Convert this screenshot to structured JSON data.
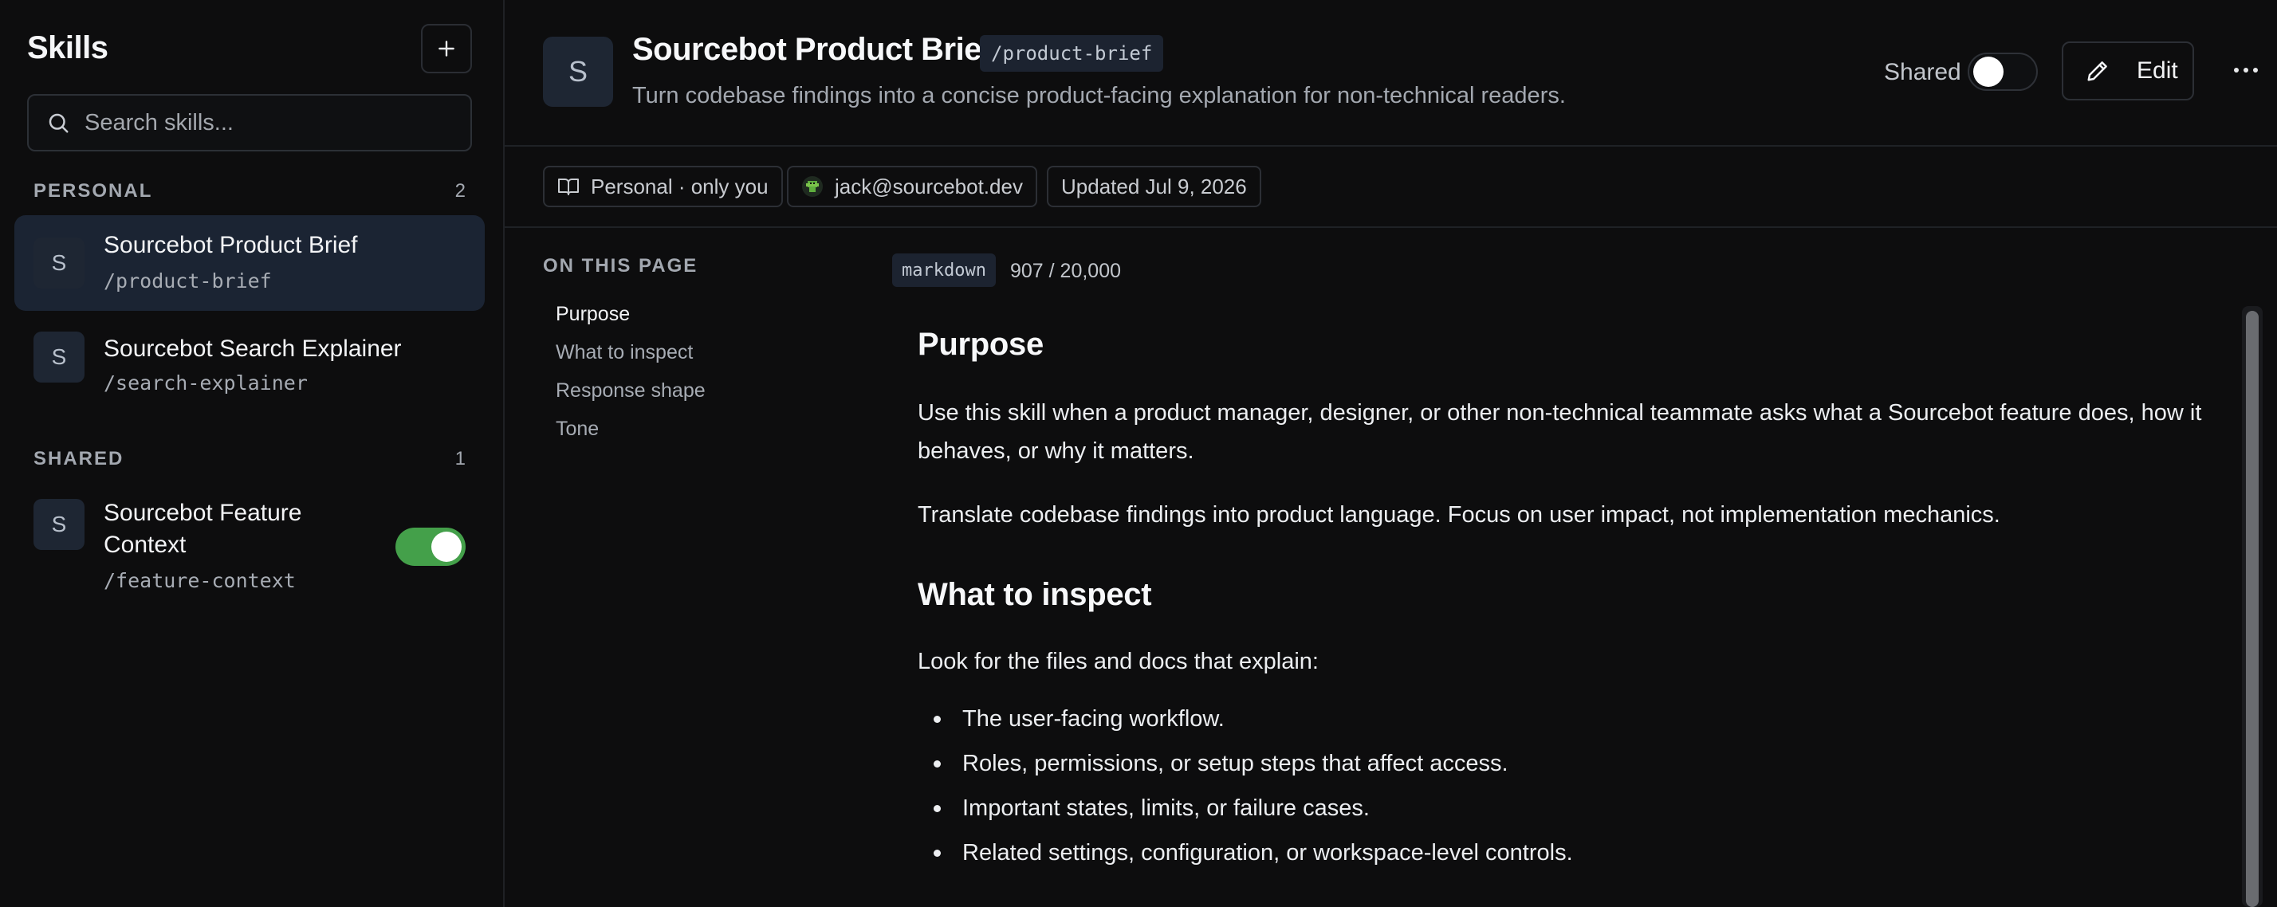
{
  "sidebar": {
    "title": "Skills",
    "search_placeholder": "Search skills...",
    "sections": [
      {
        "label": "PERSONAL",
        "count": "2"
      },
      {
        "label": "SHARED",
        "count": "1"
      }
    ],
    "personal_items": [
      {
        "avatar": "S",
        "name": "Sourcebot Product Brief",
        "slug": "/product-brief",
        "active": true
      },
      {
        "avatar": "S",
        "name": "Sourcebot Search Explainer",
        "slug": "/search-explainer",
        "active": false
      }
    ],
    "shared_items": [
      {
        "avatar": "S",
        "name_line1": "Sourcebot Feature",
        "name_line2": "Context",
        "slug": "/feature-context",
        "enabled": true
      }
    ]
  },
  "header": {
    "avatar": "S",
    "title": "Sourcebot Product Brief",
    "slug": "/product-brief",
    "description": "Turn codebase findings into a concise product-facing explanation for non-technical readers.",
    "shared_label": "Shared",
    "shared_on": false,
    "edit_label": "Edit"
  },
  "meta": {
    "visibility": "Personal · only you",
    "author": "jack@sourcebot.dev",
    "updated": "Updated Jul 9, 2026"
  },
  "toc": {
    "heading": "ON THIS PAGE",
    "items": [
      "Purpose",
      "What to inspect",
      "Response shape",
      "Tone"
    ]
  },
  "editor": {
    "format": "markdown",
    "char_count": "907 / 20,000"
  },
  "document": {
    "h_purpose": "Purpose",
    "p1_line1": "Use this skill when a product manager, designer, or other non-technical teammate asks what a Sourcebot feature does, how it",
    "p1_line2": "behaves, or why it matters.",
    "p2": "Translate codebase findings into product language. Focus on user impact, not implementation mechanics.",
    "h_inspect": "What to inspect",
    "p3": "Look for the files and docs that explain:",
    "bullets": [
      "The user-facing workflow.",
      "Roles, permissions, or setup steps that affect access.",
      "Important states, limits, or failure cases.",
      "Related settings, configuration, or workspace-level controls."
    ]
  },
  "colors": {
    "accent_active": "#1b2433",
    "toggle_on": "#44a04a",
    "background": "#0d0d0e"
  }
}
